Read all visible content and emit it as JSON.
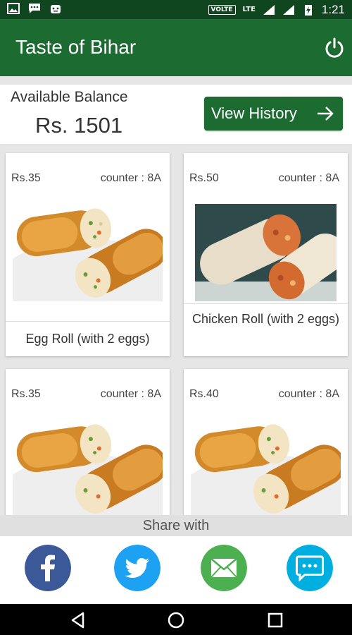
{
  "status_bar": {
    "icons_left": [
      "image-icon",
      "chat-icon",
      "android-icon"
    ],
    "volte": "VOLTE",
    "lte": "LTE",
    "time": "1:21"
  },
  "app_bar": {
    "title": "Taste of Bihar",
    "color": "#1c6b31",
    "power_icon": "power-icon"
  },
  "balance": {
    "label": "Available Balance",
    "value": "Rs. 1501",
    "history_button": "View History"
  },
  "items": [
    {
      "price": "Rs.35",
      "counter": "counter : 8A",
      "name": "Egg Roll (with 2 eggs)",
      "image": "egg-roll"
    },
    {
      "price": "Rs.50",
      "counter": "counter : 8A",
      "name": "Chicken Roll (with 2 eggs)",
      "image": "chicken-roll"
    },
    {
      "price": "Rs.35",
      "counter": "counter : 8A",
      "name": "",
      "image": "egg-roll"
    },
    {
      "price": "Rs.40",
      "counter": "counter : 8A",
      "name": "",
      "image": "egg-roll"
    }
  ],
  "share": {
    "label": "Share with",
    "buttons": [
      {
        "name": "facebook",
        "color": "#3b5998"
      },
      {
        "name": "twitter",
        "color": "#1da1f2"
      },
      {
        "name": "email",
        "color": "#4caf50"
      },
      {
        "name": "sms",
        "color": "#00aee0"
      }
    ]
  },
  "nav": [
    "back-icon",
    "home-icon",
    "recents-icon"
  ]
}
